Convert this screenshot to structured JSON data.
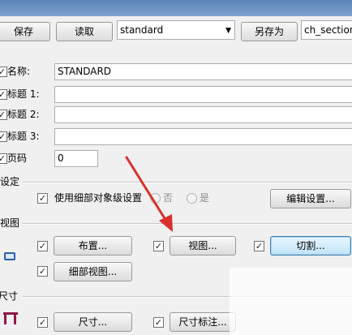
{
  "toolbar": {
    "save_label": "保存",
    "read_label": "读取",
    "preset_value": "standard",
    "saveas_label": "另存为",
    "section_value": "ch_section"
  },
  "fields": [
    {
      "label": "名称:",
      "value": "STANDARD",
      "checked": true
    },
    {
      "label": "标题 1:",
      "value": "",
      "checked": true
    },
    {
      "label": "标题 2:",
      "value": "",
      "checked": true
    },
    {
      "label": "标题 3:",
      "value": "",
      "checked": true
    },
    {
      "label": "页码",
      "value": "0",
      "checked": true
    }
  ],
  "settings": {
    "group_label": "设定",
    "use_detail_label": "使用细部对象级设置",
    "no_label": "否",
    "yes_label": "是",
    "edit_settings_label": "编辑设置..."
  },
  "views": {
    "group_label": "视图",
    "layout_label": "布置...",
    "view_label": "视图...",
    "cut_label": "切割...",
    "detail_view_label": "细部视图..."
  },
  "dimensions": {
    "group_label": "尺寸",
    "dim_label": "尺寸...",
    "dim_mark_label": "尺寸标注..."
  },
  "icons": {
    "dropdown": "chevron-down-icon",
    "view_preview": "window-icon",
    "dimension_preview": "dimension-icon",
    "annotation": "red-arrow-icon"
  },
  "colors": {
    "accent": "#3c7fb1",
    "arrow": "#d9302c",
    "dim_icon": "#8b1a4a"
  }
}
